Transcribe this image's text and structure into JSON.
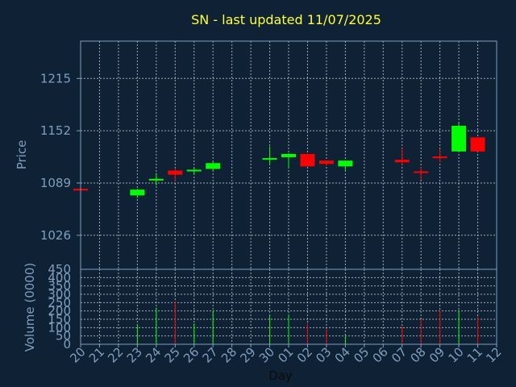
{
  "title": "SN - last updated 11/07/2025",
  "colors": {
    "background": "#0f2134",
    "axes": "#7f9fbf",
    "title": "#ffff33",
    "up": "#00ff00",
    "down": "#ff0000",
    "grid": "#cfd8e0"
  },
  "chart_data": [
    {
      "type": "candlestick",
      "ylabel": "Price",
      "yticks": [
        1026,
        1089,
        1152,
        1215
      ],
      "ylim": [
        985,
        1260
      ],
      "grid": true,
      "candles": [
        {
          "day": "20",
          "open": 1082,
          "close": 1080,
          "high": 1082,
          "low": 1080
        },
        {
          "day": "23",
          "open": 1074,
          "close": 1081,
          "high": 1082,
          "low": 1071
        },
        {
          "day": "24",
          "open": 1092,
          "close": 1094,
          "high": 1101,
          "low": 1086
        },
        {
          "day": "25",
          "open": 1104,
          "close": 1099,
          "high": 1106,
          "low": 1091
        },
        {
          "day": "26",
          "open": 1103,
          "close": 1105,
          "high": 1107,
          "low": 1100
        },
        {
          "day": "27",
          "open": 1106,
          "close": 1113,
          "high": 1115,
          "low": 1104
        },
        {
          "day": "30",
          "open": 1117,
          "close": 1119,
          "high": 1133,
          "low": 1111
        },
        {
          "day": "01",
          "open": 1120,
          "close": 1124,
          "high": 1125,
          "low": 1107
        },
        {
          "day": "02",
          "open": 1124,
          "close": 1109,
          "high": 1124,
          "low": 1109
        },
        {
          "day": "03",
          "open": 1116,
          "close": 1112,
          "high": 1116,
          "low": 1110
        },
        {
          "day": "04",
          "open": 1109,
          "close": 1116,
          "high": 1116,
          "low": 1104
        },
        {
          "day": "07",
          "open": 1117,
          "close": 1114,
          "high": 1131,
          "low": 1111
        },
        {
          "day": "08",
          "open": 1103,
          "close": 1102,
          "high": 1108,
          "low": 1093
        },
        {
          "day": "09",
          "open": 1121,
          "close": 1119,
          "high": 1130,
          "low": 1114
        },
        {
          "day": "10",
          "open": 1127,
          "close": 1158,
          "high": 1161,
          "low": 1127
        },
        {
          "day": "11",
          "open": 1144,
          "close": 1127,
          "high": 1144,
          "low": 1127
        }
      ]
    },
    {
      "type": "bar",
      "ylabel": "Volume (0000)",
      "xlabel": "Day",
      "yticks": [
        0,
        50,
        100,
        150,
        200,
        250,
        300,
        350,
        400,
        450
      ],
      "ylim": [
        0,
        450
      ],
      "x": [
        "20",
        "21",
        "22",
        "23",
        "24",
        "25",
        "26",
        "27",
        "28",
        "29",
        "30",
        "01",
        "02",
        "03",
        "04",
        "05",
        "06",
        "07",
        "08",
        "09",
        "10",
        "11",
        "12"
      ],
      "volumes": [
        {
          "day": "20",
          "value": 0,
          "dir": "up"
        },
        {
          "day": "23",
          "value": 120,
          "dir": "up"
        },
        {
          "day": "24",
          "value": 220,
          "dir": "up"
        },
        {
          "day": "25",
          "value": 260,
          "dir": "down"
        },
        {
          "day": "26",
          "value": 125,
          "dir": "up"
        },
        {
          "day": "27",
          "value": 200,
          "dir": "up"
        },
        {
          "day": "30",
          "value": 170,
          "dir": "up"
        },
        {
          "day": "01",
          "value": 180,
          "dir": "up"
        },
        {
          "day": "02",
          "value": 125,
          "dir": "down"
        },
        {
          "day": "03",
          "value": 95,
          "dir": "down"
        },
        {
          "day": "04",
          "value": 50,
          "dir": "up"
        },
        {
          "day": "07",
          "value": 110,
          "dir": "down"
        },
        {
          "day": "08",
          "value": 150,
          "dir": "down"
        },
        {
          "day": "09",
          "value": 205,
          "dir": "down"
        },
        {
          "day": "10",
          "value": 200,
          "dir": "up"
        },
        {
          "day": "11",
          "value": 165,
          "dir": "down"
        }
      ]
    }
  ]
}
